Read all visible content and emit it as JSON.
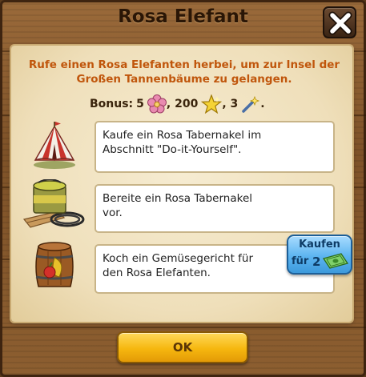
{
  "dialog": {
    "title": "Rosa Elefant",
    "description_line1": "Rufe einen Rosa Elefanten herbei, um zur Insel der",
    "description_line2": "Großen Tannenbäume zu gelangen."
  },
  "bonus": {
    "label": "Bonus:",
    "items": [
      {
        "value": "5",
        "icon": "pink-flower-icon"
      },
      {
        "value": ", 200",
        "icon": "gold-star-icon"
      },
      {
        "value": ", 3",
        "icon": "magic-wand-icon"
      },
      {
        "value": "."
      }
    ]
  },
  "tasks": [
    {
      "icon": "tent-icon",
      "text_line1": "Kaufe ein Rosa Tabernakel im",
      "text_line2": "Abschnitt \"Do-it-Yourself\"."
    },
    {
      "icon": "paint-bucket-icon",
      "text_line1": "Bereite ein Rosa Tabernakel",
      "text_line2": "vor."
    },
    {
      "icon": "barrel-icon",
      "text_line1": "Koch ein Gemüsegericht für",
      "text_line2": "den Rosa Elefanten."
    }
  ],
  "buy_button": {
    "label": "Kaufen",
    "for_label": "für",
    "cost": "2",
    "currency_icon": "green-bill-icon"
  },
  "ok_button": {
    "label": "OK"
  },
  "colors": {
    "description": "#c0560c",
    "buy_button": "#5cb4f0",
    "ok_button": "#f6b70f",
    "wood": "#8c5e30",
    "parchment": "#f6ecd2"
  }
}
